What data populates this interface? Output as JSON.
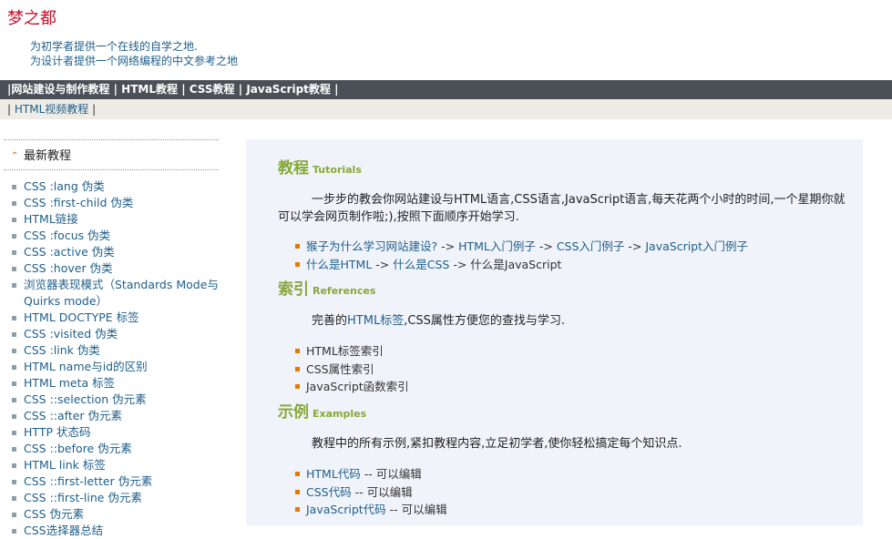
{
  "header": {
    "title": "梦之都",
    "slogan1": "为初学者提供一个在线的自学之地.",
    "slogan2": "为设计者提供一个网络编程的中文参考之地"
  },
  "nav_main": {
    "sep": "|",
    "items": [
      "网站建设与制作教程",
      "HTML教程",
      "CSS教程",
      "JavaScript教程"
    ]
  },
  "nav_sub": {
    "sep": "|",
    "items": [
      "HTML视频教程"
    ]
  },
  "sidebar": {
    "heading": "最新教程",
    "items": [
      "CSS :lang 伪类",
      "CSS :first-child 伪类",
      "HTML链接",
      "CSS :focus 伪类",
      "CSS :active 伪类",
      "CSS :hover 伪类",
      "浏览器表现模式（Standards Mode与Quirks mode）",
      "HTML DOCTYPE 标签",
      "CSS :visited 伪类",
      "CSS :link 伪类",
      "HTML name与id的区别",
      "HTML meta 标签",
      "CSS ::selection 伪元素",
      "CSS ::after 伪元素",
      "HTTP 状态码",
      "CSS ::before 伪元素",
      "HTML link 标签",
      "CSS ::first-letter 伪元素",
      "CSS ::first-line 伪元素",
      "CSS 伪元素",
      "CSS选择器总结"
    ]
  },
  "main": {
    "tutorials": {
      "title": "教程",
      "subtitle": "Tutorials",
      "desc": "一步步的教会你网站建设与HTML语言,CSS语言,JavaScript语言,每天花两个小时的时间,一个星期你就可以学会网页制作啦;),按照下面顺序开始学习.",
      "line1": [
        "猴子为什么学习网站建设?",
        " -> ",
        "HTML入门例子",
        " -> ",
        "CSS入门例子",
        " -> ",
        "JavaScript入门例子"
      ],
      "line2": [
        "什么是HTML",
        " -> ",
        "什么是CSS",
        " -> ",
        "什么是JavaScript"
      ]
    },
    "references": {
      "title": "索引",
      "subtitle": "References",
      "desc_before": "完善的",
      "desc_link": "HTML标签",
      "desc_after": ",CSS属性方便您的查找与学习.",
      "items": [
        "HTML标签索引",
        "CSS属性索引",
        "JavaScript函数索引"
      ]
    },
    "examples": {
      "title": "示例",
      "subtitle": "Examples",
      "desc": "教程中的所有示例,紧扣教程内容,立足初学者,使你轻松搞定每个知识点.",
      "items": [
        {
          "link": "HTML代码",
          "note": " -- 可以编辑"
        },
        {
          "link": "CSS代码",
          "note": " -- 可以编辑"
        },
        {
          "link": "JavaScript代码",
          "note": " -- 可以编辑"
        }
      ]
    }
  },
  "colors": {
    "title_red": "#c8102e",
    "nav_dark": "#4b4f56",
    "section_green": "#86a83a",
    "link_blue": "#1f5f8b",
    "bullet_orange": "#e07b00"
  }
}
